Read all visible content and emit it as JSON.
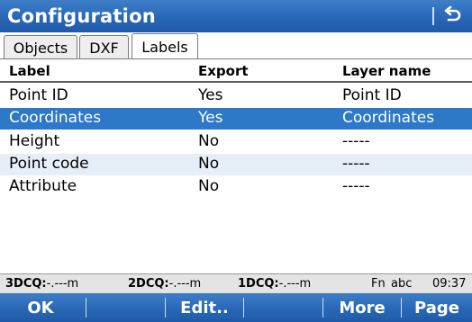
{
  "window": {
    "title": "Configuration"
  },
  "tabs": [
    {
      "label": "Objects",
      "active": false
    },
    {
      "label": "DXF",
      "active": false
    },
    {
      "label": "Labels",
      "active": true
    }
  ],
  "table": {
    "columns": [
      "Label",
      "Export",
      "Layer name"
    ],
    "rows": [
      {
        "label": "Point ID",
        "export": "Yes",
        "layer": "Point ID",
        "selected": false
      },
      {
        "label": "Coordinates",
        "export": "Yes",
        "layer": "Coordinates",
        "selected": true
      },
      {
        "label": "Height",
        "export": "No",
        "layer": "-----",
        "selected": false
      },
      {
        "label": "Point code",
        "export": "No",
        "layer": "-----",
        "selected": false
      },
      {
        "label": "Attribute",
        "export": "No",
        "layer": "-----",
        "selected": false
      }
    ]
  },
  "status": {
    "dcq3_label": "3DCQ:",
    "dcq3_value": "-.---m",
    "dcq2_label": "2DCQ:",
    "dcq2_value": "-.---m",
    "dcq1_label": "1DCQ:",
    "dcq1_value": "-.---m",
    "fn": "Fn",
    "input_mode": "abc",
    "time": "09:37"
  },
  "softkeys": {
    "f1": "OK",
    "f2": "",
    "f3": "Edit..",
    "f4": "",
    "f5": "More",
    "f6": "Page"
  },
  "colors": {
    "accent": "#2a69b8",
    "selection": "#2d78c7",
    "alt_row": "#e6eef8"
  }
}
